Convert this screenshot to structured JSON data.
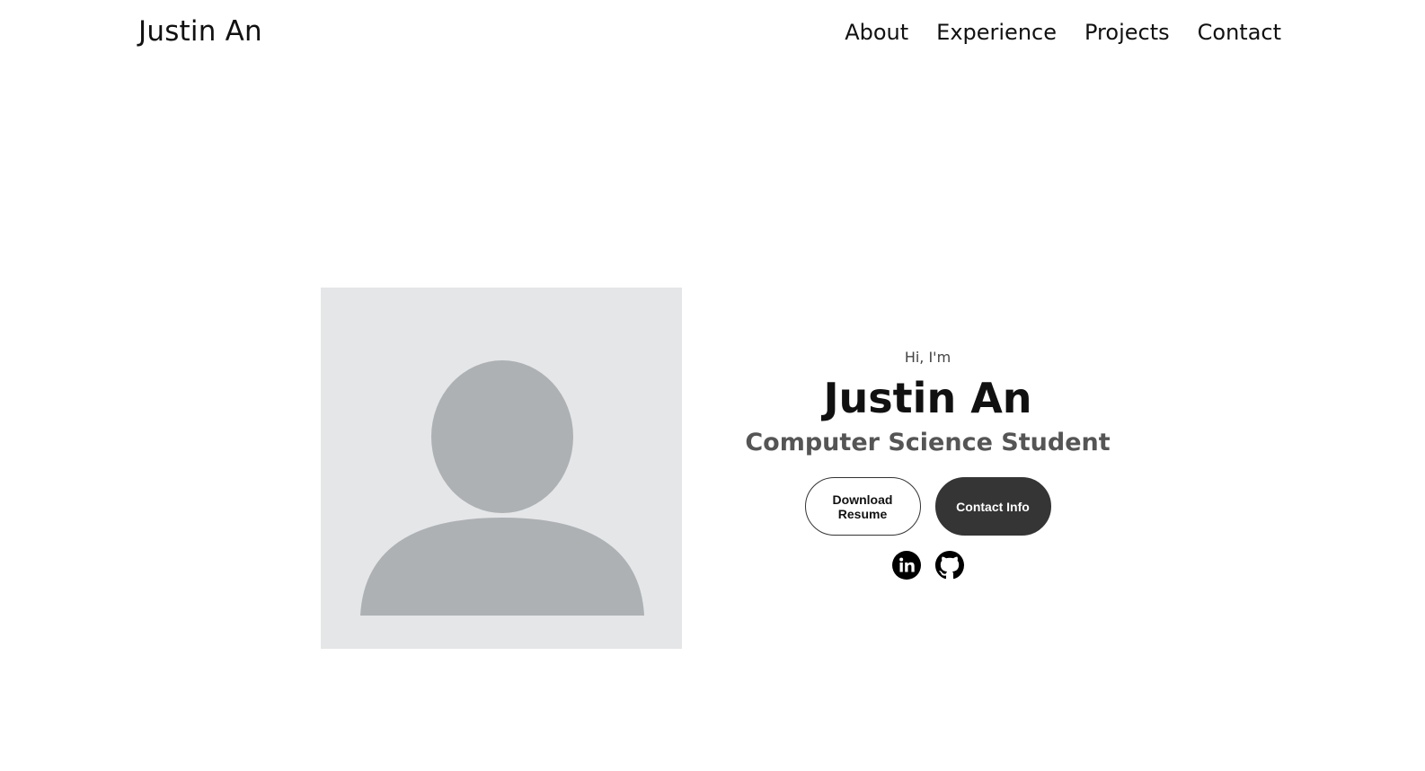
{
  "nav": {
    "logo": "Justin An",
    "links": [
      "About",
      "Experience",
      "Projects",
      "Contact"
    ]
  },
  "hero": {
    "greeting": "Hi, I'm",
    "name": "Justin An",
    "title": "Computer Science Student",
    "buttons": {
      "resume": "Download Resume",
      "contact": "Contact Info"
    },
    "socials": [
      "linkedin-icon",
      "github-icon"
    ]
  },
  "colors": {
    "placeholder_bg": "#e5e6e8",
    "placeholder_fg": "#adb1b4",
    "button_dark": "#353535"
  }
}
